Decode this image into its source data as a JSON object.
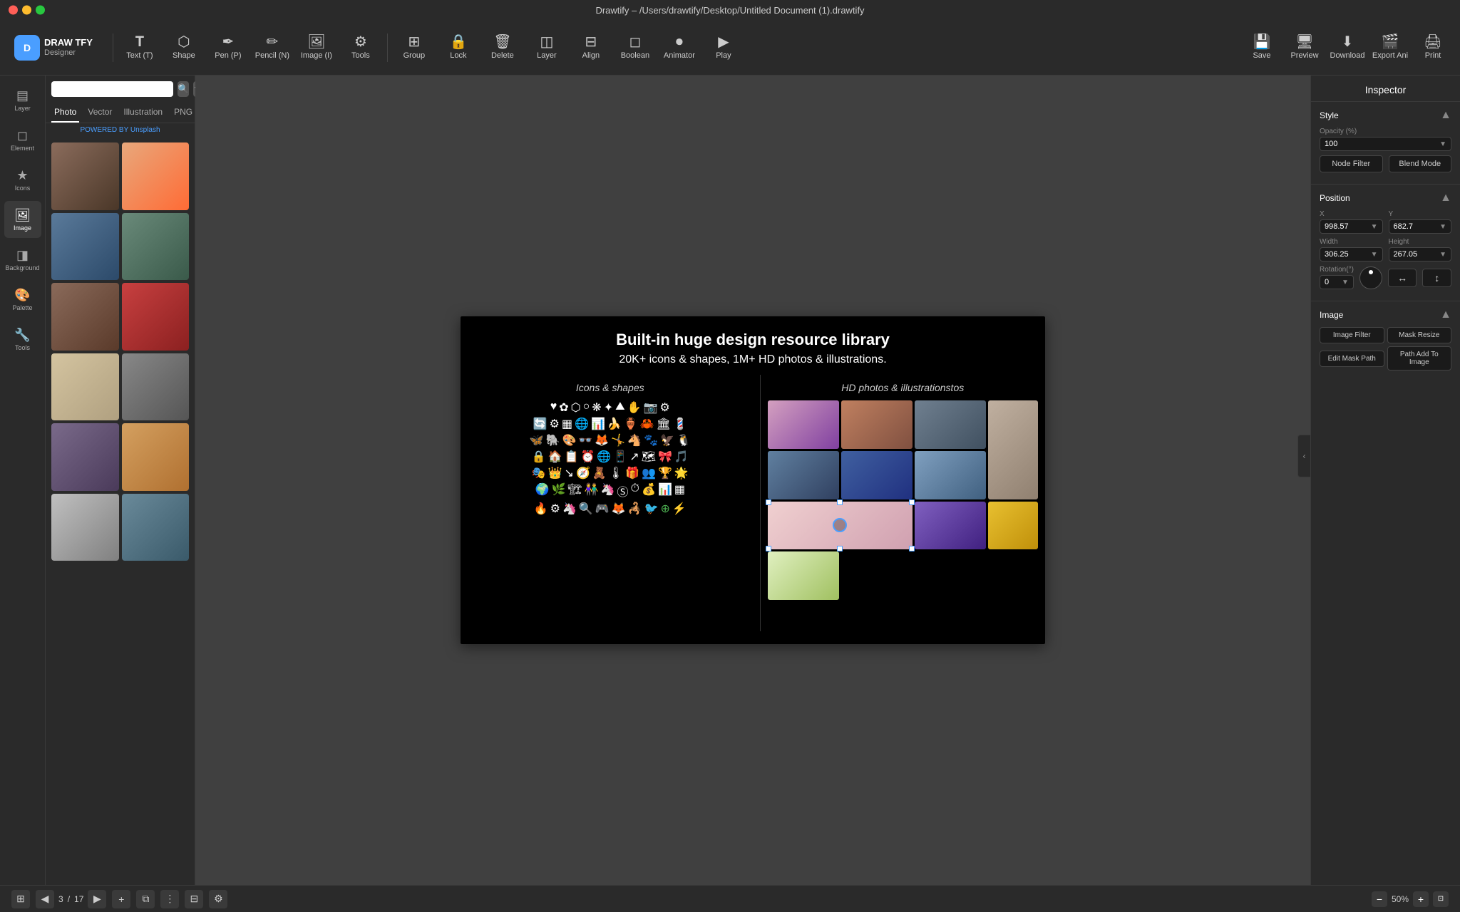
{
  "titlebar": {
    "title": "Drawtify – /Users/drawtify/Desktop/Untitled Document (1).drawtify"
  },
  "toolbar": {
    "tools": [
      {
        "id": "text",
        "icon": "T",
        "label": "Text (T)"
      },
      {
        "id": "shape",
        "icon": "⬡",
        "label": "Shape"
      },
      {
        "id": "pen",
        "icon": "✒",
        "label": "Pen (P)"
      },
      {
        "id": "pencil",
        "icon": "✏",
        "label": "Pencil (N)"
      },
      {
        "id": "image",
        "icon": "🖼",
        "label": "Image (I)"
      },
      {
        "id": "tools",
        "icon": "⚙",
        "label": "Tools"
      }
    ],
    "actions": [
      {
        "id": "group",
        "icon": "⊞",
        "label": "Group"
      },
      {
        "id": "lock",
        "icon": "🔒",
        "label": "Lock"
      },
      {
        "id": "delete",
        "icon": "🗑",
        "label": "Delete"
      },
      {
        "id": "layer",
        "icon": "◫",
        "label": "Layer"
      },
      {
        "id": "align",
        "icon": "⊟",
        "label": "Align"
      },
      {
        "id": "boolean",
        "icon": "◻",
        "label": "Boolean"
      },
      {
        "id": "animator",
        "icon": "⏺",
        "label": "Animator"
      },
      {
        "id": "play",
        "icon": "▶",
        "label": "Play"
      }
    ],
    "right": [
      {
        "id": "save",
        "icon": "💾",
        "label": "Save"
      },
      {
        "id": "preview",
        "icon": "🖥",
        "label": "Preview"
      },
      {
        "id": "download",
        "icon": "⬇",
        "label": "Download"
      },
      {
        "id": "export-ani",
        "icon": "🎬",
        "label": "Export Ani"
      },
      {
        "id": "print",
        "icon": "🖨",
        "label": "Print"
      }
    ]
  },
  "sidebar": {
    "items": [
      {
        "id": "layer",
        "icon": "▤",
        "label": "Layer"
      },
      {
        "id": "element",
        "icon": "◻",
        "label": "Element"
      },
      {
        "id": "icons",
        "icon": "★",
        "label": "Icons"
      },
      {
        "id": "image",
        "icon": "🖼",
        "label": "Image",
        "active": true
      },
      {
        "id": "background",
        "icon": "◨",
        "label": "Background"
      },
      {
        "id": "palette",
        "icon": "🎨",
        "label": "Palette"
      },
      {
        "id": "tools",
        "icon": "🔧",
        "label": "Tools"
      }
    ]
  },
  "panel": {
    "search_placeholder": "",
    "tabs": [
      "Photo",
      "Vector",
      "Illustration",
      "PNG"
    ],
    "active_tab": "Photo",
    "powered_by": "POWERED BY",
    "powered_link": "Unsplash"
  },
  "canvas": {
    "title": "Built-in huge design resource library",
    "subtitle": "20K+ icons & shapes, 1M+ HD photos & illustrations.",
    "left_heading": "Icons & shapes",
    "right_heading": "HD photos & illustrationstos"
  },
  "inspector": {
    "title": "Inspector",
    "style": {
      "label": "Style",
      "opacity_label": "Opacity (%)",
      "opacity_value": "100",
      "node_filter": "Node Filter",
      "blend_mode": "Blend Mode"
    },
    "position": {
      "label": "Position",
      "x_label": "X",
      "x_value": "998.57",
      "y_label": "Y",
      "y_value": "682.7",
      "width_label": "Width",
      "width_value": "306.25",
      "height_label": "Height",
      "height_value": "267.05",
      "rotation_label": "Rotation(°)",
      "rotation_value": "0"
    },
    "image": {
      "label": "Image",
      "image_filter": "Image Filter",
      "mask_resize": "Mask Resize",
      "edit_mask_path": "Edit Mask Path",
      "path_add": "Path Add To Image"
    }
  },
  "bottombar": {
    "page_prev": "◀",
    "page_next": "▶",
    "page_current": "3",
    "page_total": "17",
    "page_separator": "/",
    "add_page": "+",
    "zoom_out": "−",
    "zoom_level": "50%",
    "zoom_in": "+"
  }
}
